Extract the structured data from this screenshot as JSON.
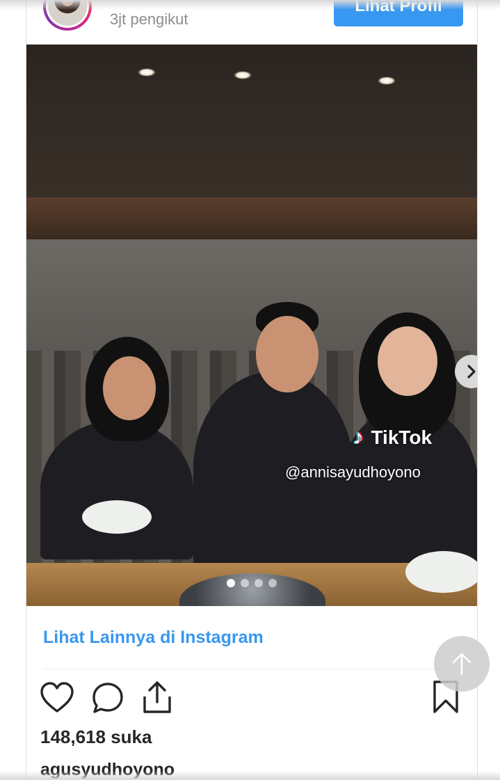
{
  "header": {
    "followers": "3jt pengikut",
    "profile_button_label": "Lihat Profil"
  },
  "media": {
    "overlay": {
      "brand": "TikTok",
      "handle": "@annisayudhoyono"
    },
    "carousel": {
      "total_slides": 4,
      "active_slide": 1
    }
  },
  "footer": {
    "more_link": "Lihat Lainnya di Instagram",
    "likes": "148,618 suka",
    "username": "agusyudhoyono"
  },
  "icons": {
    "like": "heart-icon",
    "comment": "comment-icon",
    "share": "share-icon",
    "save": "bookmark-icon",
    "next": "chevron-right-icon",
    "scroll_top": "arrow-up-icon"
  },
  "colors": {
    "accent": "#3897f0",
    "text": "#262626",
    "muted": "#8e8e8e"
  }
}
